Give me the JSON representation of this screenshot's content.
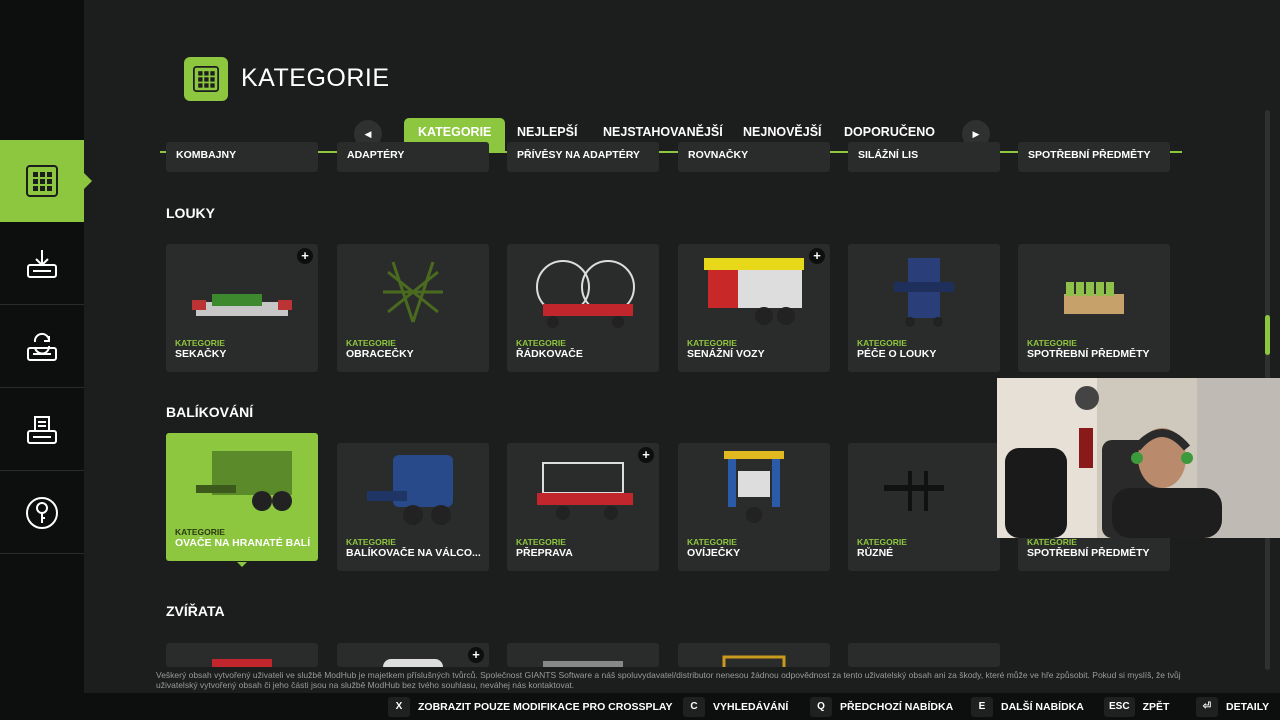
{
  "header": {
    "title": "KATEGORIE"
  },
  "tabs": {
    "items": [
      "KATEGORIE",
      "NEJLEPŠÍ",
      "NEJSTAHOVANĚJŠÍ",
      "NEJNOVĚJŠÍ",
      "DOPORUČENO"
    ],
    "active": "KATEGORIE"
  },
  "sidebar": {
    "items": [
      {
        "name": "categories",
        "icon": "grid-icon",
        "active": true
      },
      {
        "name": "downloads",
        "icon": "download-icon"
      },
      {
        "name": "updates",
        "icon": "update-icon"
      },
      {
        "name": "purchases",
        "icon": "purchase-icon"
      },
      {
        "name": "dlc",
        "icon": "key-icon"
      }
    ]
  },
  "top_row": [
    "KOMBAJNY",
    "ADAPTÉRY",
    "PŘÍVĚSY NA ADAPTÉRY",
    "ROVNAČKY",
    "SILÁŽNÍ LIS",
    "SPOTŘEBNÍ PŘEDMĚTY"
  ],
  "sections": [
    {
      "title": "LOUKY",
      "cards": [
        {
          "cat": "KATEGORIE",
          "name": "SEKAČKY",
          "plus": true
        },
        {
          "cat": "KATEGORIE",
          "name": "OBRACEČKY"
        },
        {
          "cat": "KATEGORIE",
          "name": "ŘÁDKOVAČE"
        },
        {
          "cat": "KATEGORIE",
          "name": "SENÁŽNÍ VOZY",
          "plus": true
        },
        {
          "cat": "KATEGORIE",
          "name": "PÉČE O LOUKY"
        },
        {
          "cat": "KATEGORIE",
          "name": "SPOTŘEBNÍ PŘEDMĚTY"
        }
      ]
    },
    {
      "title": "BALÍKOVÁNÍ",
      "cards": [
        {
          "cat": "KATEGORIE",
          "name": "OVAČE NA HRANATÉ BALÍ",
          "selected": true
        },
        {
          "cat": "KATEGORIE",
          "name": "BALÍKOVAČE NA VÁLCO..."
        },
        {
          "cat": "KATEGORIE",
          "name": "PŘEPRAVA",
          "plus": true
        },
        {
          "cat": "KATEGORIE",
          "name": "OVÍJEČKY"
        },
        {
          "cat": "KATEGORIE",
          "name": "RŮZNÉ"
        },
        {
          "cat": "KATEGORIE",
          "name": "SPOTŘEBNÍ PŘEDMĚTY"
        }
      ]
    },
    {
      "title": "ZVÍŘATA",
      "cards": []
    }
  ],
  "disclaimer": "Veškerý obsah vytvořený uživateli ve službě ModHub je majetkem příslušných tvůrců. Společnost GIANTS Software a náš spoluvydavatel/distributor nenesou žádnou odpovědnost za tento uživatelský obsah ani za škody, které může ve hře způsobit. Pokud si myslíš, že tvůj uživatelský vytvořený obsah či jeho části jsou na službě ModHub bez tvého souhlasu, neváhej nás kontaktovat.",
  "footer": [
    {
      "key": "X",
      "label": "ZOBRAZIT POUZE MODIFIKACE PRO CROSSPLAY"
    },
    {
      "key": "C",
      "label": "VYHLEDÁVÁNÍ"
    },
    {
      "key": "Q",
      "label": "PŘEDCHOZÍ NABÍDKA"
    },
    {
      "key": "E",
      "label": "DALŠÍ NABÍDKA"
    },
    {
      "key": "ESC",
      "label": "ZPĚT"
    },
    {
      "key": "⏎",
      "label": "DETAILY"
    }
  ],
  "colors": {
    "accent": "#8dc63f",
    "bg": "#1c1d1d",
    "card": "#2a2b2b"
  }
}
